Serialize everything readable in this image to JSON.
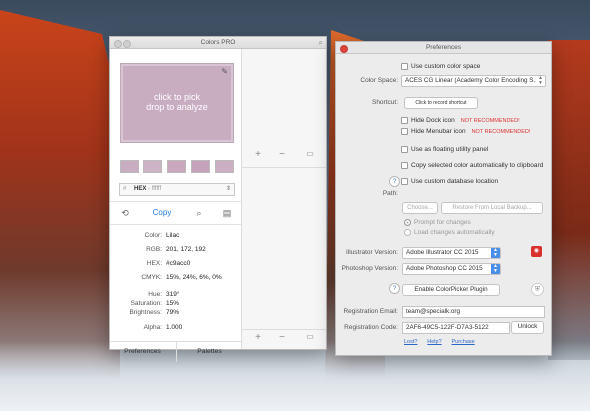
{
  "colors_window": {
    "title": "Colors PRO",
    "swatch_hint_line1": "click to pick",
    "swatch_hint_line2": "drop to analyze",
    "swatch_color": "#c8acc0",
    "history_swatches": [
      "#c8acc0",
      "#cdb4c4",
      "#c9a8be",
      "#c4a2bb",
      "#cbaec2"
    ],
    "format_label": "HEX",
    "format_example": "- ffffff",
    "copy_label": "Copy",
    "info": [
      {
        "key": "Color:",
        "value": "Lilac"
      },
      {
        "key": "RGB:",
        "value": "201, 172, 192"
      },
      {
        "key": "HEX:",
        "value": "#c9acc0"
      },
      {
        "key": "CMYK:",
        "value": "15%, 24%, 6%, 0%"
      },
      {
        "key": "Hue:",
        "value": "319°"
      },
      {
        "key": "Saturation:",
        "value": "15%"
      },
      {
        "key": "Brightness:",
        "value": "79%"
      },
      {
        "key": "Alpha:",
        "value": "1.000"
      }
    ],
    "tab_preferences": "Preferences",
    "tab_palettes": "Palettes"
  },
  "prefs_window": {
    "title": "Preferences",
    "use_custom_color_space": "Use custom color space",
    "color_space_label": "Color Space:",
    "color_space_value": "ACES CG Linear (Academy Color Encoding S...",
    "shortcut_label": "Shortcut:",
    "shortcut_button": "Click to record shortcut",
    "hide_dock_icon": "Hide Dock icon",
    "hide_menubar_icon": "Hide Menubar icon",
    "not_recommended": "NOT RECOMMENDED!",
    "floating_panel": "Use as floating utility panel",
    "copy_auto": "Copy selected color automatically to clipboard",
    "use_custom_db": "Use custom database location",
    "path_label": "Path:",
    "choose_button": "Choose...",
    "restore_button": "Restore From Local Backup...",
    "prompt_changes": "Prompt for changes",
    "load_changes": "Load changes automatically",
    "illustrator_label": "Illustrator Version:",
    "illustrator_value": "Adobe Illustrator CC 2015",
    "photoshop_label": "Photoshop Version:",
    "photoshop_value": "Adobe Photoshop CC 2015",
    "enable_plugin": "Enable ColorPicker Plugin",
    "reg_email_label": "Registration Email:",
    "reg_email_value": "team@specialk.org",
    "reg_code_label": "Registration Code:",
    "reg_code_value": "2AF6-49C5-122F-D7A3-5122",
    "unlock_button": "Unlock",
    "link_lost": "Lost?",
    "link_help": "Help?",
    "link_purchase": "Purchase"
  }
}
